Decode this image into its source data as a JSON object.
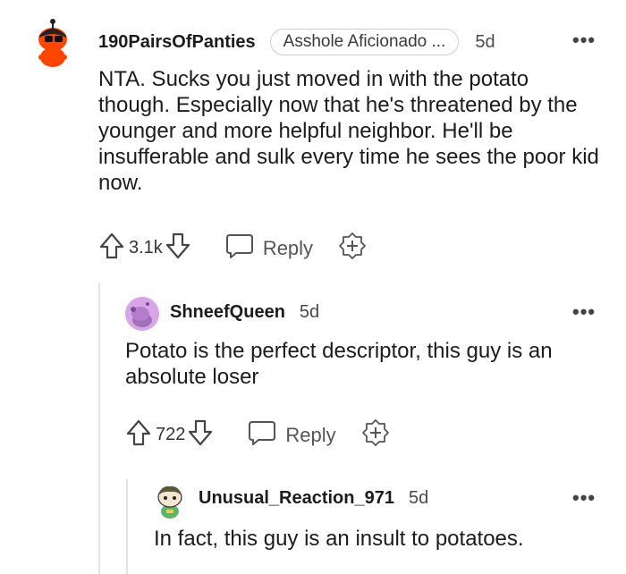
{
  "comments": [
    {
      "username": "190PairsOfPanties",
      "flair": "Asshole Aficionado ...",
      "time": "5d",
      "body": "NTA. Sucks you just moved in with the potato though. Especially now that he's threatened by the younger and more helpful neighbor. He'll be insufferable and sulk every time he sees the poor kid now.",
      "votes": "3.1k",
      "reply_label": "Reply",
      "more": "•••"
    },
    {
      "username": "ShneefQueen",
      "time": "5d",
      "body": "Potato is the perfect descriptor, this guy is an absolute loser",
      "votes": "722",
      "reply_label": "Reply",
      "more": "•••"
    },
    {
      "username": "Unusual_Reaction_971",
      "time": "5d",
      "body": "In fact, this guy is an insult to potatoes.",
      "more": "•••"
    }
  ],
  "icons": {
    "upvote": "upvote-arrow-icon",
    "downvote": "downvote-arrow-icon",
    "reply": "speech-bubble-icon",
    "award": "award-plus-icon"
  },
  "colors": {
    "avatar1": "#ff4500",
    "avatar2": "#d8a5e8",
    "avatar3_hair": "#5a5a3a",
    "avatar3_shirt": "#5fb36a"
  }
}
